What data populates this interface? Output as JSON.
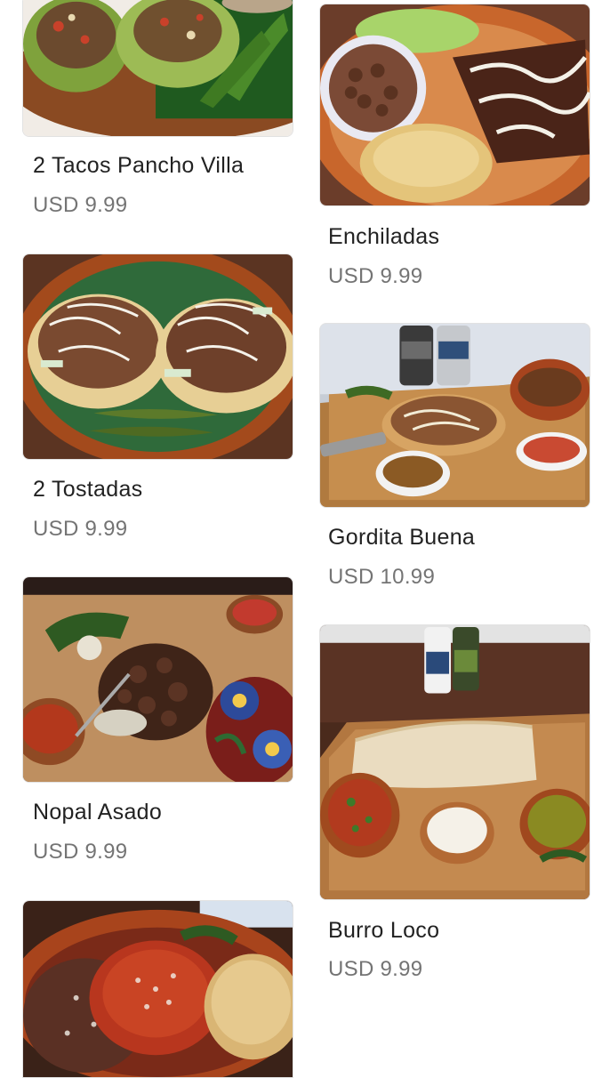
{
  "menu": {
    "currency": "USD",
    "items": [
      {
        "name": "2 Tacos Pancho Villa",
        "price": "USD 9.99",
        "image": "tacos-photo"
      },
      {
        "name": "Enchiladas",
        "price": "USD 9.99",
        "image": "enchiladas-photo"
      },
      {
        "name": "2 Tostadas",
        "price": "USD 9.99",
        "image": "tostadas-photo"
      },
      {
        "name": "Gordita Buena",
        "price": "USD 10.99",
        "image": "gordita-photo"
      },
      {
        "name": "Nopal Asado",
        "price": "USD 9.99",
        "image": "nopal-photo"
      },
      {
        "name": "Burro Loco",
        "price": "USD 9.99",
        "image": "burro-photo"
      },
      {
        "name": "",
        "price": "",
        "image": "plate-photo"
      }
    ]
  }
}
